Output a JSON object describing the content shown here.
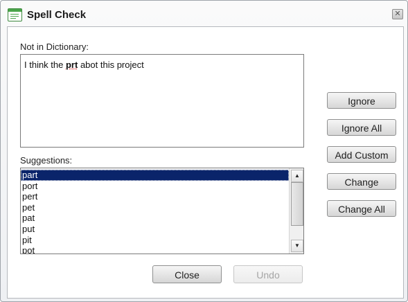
{
  "window": {
    "title": "Spell Check",
    "close_glyph": "✕"
  },
  "not_in_dictionary": {
    "label": "Not in Dictionary:",
    "text_before": "I think the ",
    "misspelled_word": "prt",
    "text_after": " abot this project"
  },
  "suggestions": {
    "label": "Suggestions:",
    "items": [
      "part",
      "port",
      "pert",
      "pet",
      "pat",
      "put",
      "pit",
      "pot"
    ],
    "selected": "part"
  },
  "buttons": {
    "ignore": "Ignore",
    "ignore_all": "Ignore All",
    "add_custom": "Add Custom",
    "change": "Change",
    "change_all": "Change All",
    "close": "Close",
    "undo": "Undo"
  },
  "icons": {
    "app": "spellcheck-document-icon",
    "scroll_up": "▲",
    "scroll_down": "▼"
  }
}
